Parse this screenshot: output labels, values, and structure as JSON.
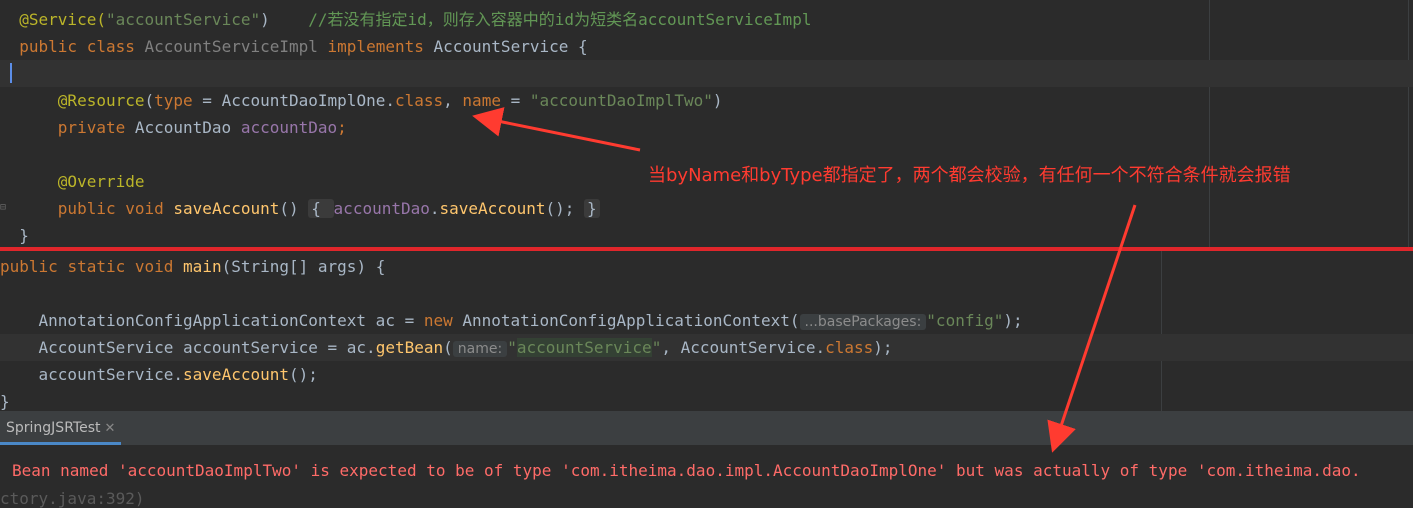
{
  "editor_top": {
    "lines": [
      {
        "parts": [
          "@Service(",
          "\"accountService\"",
          ")    ",
          "//若没有指定id，则存入容器中的id为短类名accountServiceImpl"
        ]
      },
      {
        "parts": [
          "public ",
          "class ",
          "AccountServiceImpl ",
          "implements ",
          "AccountService",
          " {"
        ]
      },
      {
        "parts": [
          ""
        ]
      },
      {
        "parts": [
          "    @Resource",
          "(",
          "type",
          " = ",
          "AccountDaoImplOne",
          ".",
          "class",
          ", ",
          "name",
          " = ",
          "\"accountDaoImplTwo\"",
          ")"
        ]
      },
      {
        "parts": [
          "    private ",
          "AccountDao ",
          "accountDao",
          ";"
        ]
      },
      {
        "parts": [
          ""
        ]
      },
      {
        "parts": [
          "    @Override"
        ]
      },
      {
        "parts": [
          "    public ",
          "void ",
          "saveAccount",
          "() ",
          "{ ",
          "accountDao",
          ".",
          "saveAccount",
          "(); ",
          "}"
        ]
      },
      {
        "parts": [
          "}"
        ]
      }
    ]
  },
  "editor_bottom": {
    "lines": [
      {
        "parts": [
          "public ",
          "static ",
          "void ",
          "main",
          "(String[] args) {"
        ]
      },
      {
        "parts": [
          ""
        ]
      },
      {
        "parts": [
          "    AnnotationConfigApplicationContext ac = ",
          "new ",
          "AnnotationConfigApplicationContext(",
          "...basePackages:",
          "\"config\"",
          ");"
        ]
      },
      {
        "parts": [
          "    AccountService accountService = ac.",
          "getBean",
          "(",
          "name:",
          "\"",
          "accountService",
          "\"",
          ", AccountService.",
          "class",
          ");"
        ]
      },
      {
        "parts": [
          "    accountService.",
          "saveAccount",
          "();"
        ]
      },
      {
        "parts": [
          "}"
        ]
      }
    ]
  },
  "annotation": {
    "callout_text": "当byName和byType都指定了，两个都会校验，有任何一个不符合条件就会报错",
    "color": "#ff3b30"
  },
  "run_window": {
    "tab_label": "SpringJSRTest",
    "close_icon": "close-icon",
    "error_line": "Bean named 'accountDaoImplTwo' is expected to be of type 'com.itheima.dao.impl.AccountDaoImplOne' but was actually of type 'com.itheima.dao.",
    "trace_line": "ctory.java:392)"
  },
  "colors": {
    "background": "#2b2b2b",
    "keyword": "#cc7832",
    "string": "#6a8759",
    "annotation": "#bbb529",
    "field": "#9876aa",
    "method": "#ffc66d",
    "error": "#ff6b68",
    "divider": "#e0262b"
  }
}
